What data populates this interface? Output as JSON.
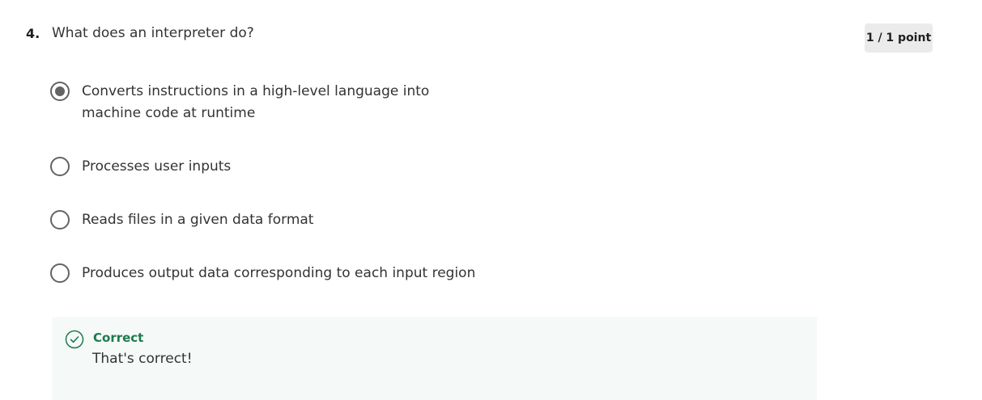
{
  "question": {
    "number": "4.",
    "text": "What does an interpreter do?"
  },
  "score": {
    "label": "1 / 1 point"
  },
  "options": [
    {
      "label": "Converts instructions in a high-level language into machine code at runtime",
      "selected": true
    },
    {
      "label": "Processes user inputs",
      "selected": false
    },
    {
      "label": "Reads files in a given data format",
      "selected": false
    },
    {
      "label": "Produces output data corresponding to each input region",
      "selected": false
    }
  ],
  "feedback": {
    "title": "Correct",
    "message": "That's correct!",
    "accent_color": "#1e7a4c",
    "icon": "check-circle-icon"
  },
  "colors": {
    "radio": "#636363",
    "badge_bg": "#ebebeb",
    "feedback_bg": "#f5f9f8"
  }
}
